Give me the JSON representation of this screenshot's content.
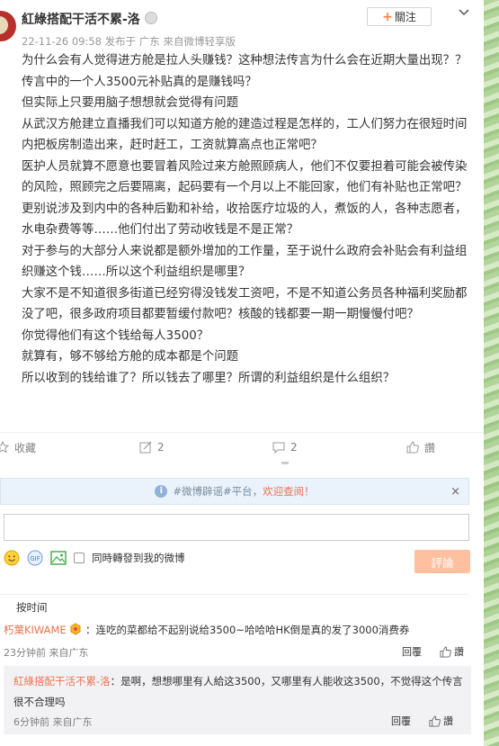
{
  "post": {
    "username": "紅綠搭配干活不累-洛",
    "meta": "22-11-26 09:58 发布于 广东 來自微博轻享版",
    "follow_label": "關注",
    "paragraphs": [
      "为什么会有人觉得进方舱是拉人头赚钱？这种想法传言为什么会在近期大量出现？？",
      "传言中的一个人3500元补贴真的是赚钱吗？",
      "但实际上只要用脑子想想就会觉得有问题",
      "从武汉方舱建立直播我们可以知道方舱的建造过程是怎样的，工人们努力在很短时间内把板房制造出来，赶时赶工，工资就算高点也正常吧？",
      "医护人员就算不愿意也要冒着风险过来方舱照顾病人，他们不仅要担着可能会被传染的风险，照顾完之后要隔离，起码要有一个月以上不能回家，他们有补贴也正常吧？",
      "更别说涉及到内中的各种后勤和补给，收拾医疗垃圾的人，煮饭的人，各种志愿者，水电杂费等等……他们付出了劳动收钱是不是正常？",
      "对于参与的大部分人来说都是额外增加的工作量，至于说什么政府会补贴会有利益组织赚这个钱……所以这个利益组织是哪里？",
      "大家不是不知道很多街道已经穷得没钱发工资吧，不是不知道公务员各种福利奖励都没了吧，很多政府项目都要暂缓付款吧？核酸的钱都要一期一期慢慢付吧？",
      "你觉得他们有这个钱给每人3500？",
      "就算有，够不够给方舱的成本都是个问题",
      "所以收到的钱给谁了？所以钱去了哪里？所谓的利益组织是什么组织？"
    ]
  },
  "toolbar": {
    "favorite_label": "收藏",
    "repost_count": "2",
    "comment_count": "2",
    "like_label": "讚"
  },
  "notice": {
    "prefix": "#微博辟谣#平台，",
    "highlight": "欢迎查阅！",
    "close": "×"
  },
  "compose": {
    "input_value": "",
    "share_label": "同時轉發到我的微博",
    "submit_label": "評論"
  },
  "comments": {
    "sort_label": "按时间",
    "items": [
      {
        "author": "朽葉KIWAME",
        "text": "：连吃的菜都给不起别说给3500~哈哈哈HK倒是真的发了3000消费券",
        "meta": "23分钟前 来自广东",
        "reply_label": "回覆",
        "like_label": "讚"
      },
      {
        "author": "紅綠搭配干活不累-洛",
        "text": "：是啊，想想哪里有人給这3500，又哪里有人能收这3500，不觉得这个传言很不合理吗",
        "meta": "6分钟前 来自广东",
        "reply_label": "回覆",
        "like_label": "讚"
      }
    ]
  },
  "colors": {
    "accent": "#eb7350",
    "follow_plus": "#ff8140",
    "notice_bg": "#eaf3fb",
    "submit_disabled": "#ffc09f"
  }
}
